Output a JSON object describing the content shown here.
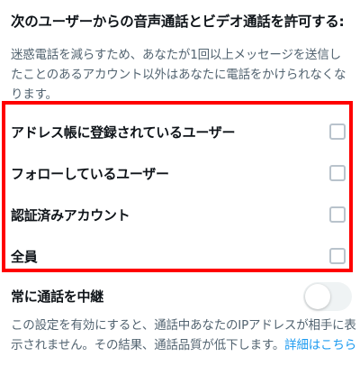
{
  "heading": "次のユーザーからの音声通話とビデオ通話を許可する:",
  "description": "迷惑電話を減らすため、あなたが1回以上メッセージを送信したことのあるアカウント以外はあなたに電話をかけられなくなります。",
  "options": [
    {
      "label": "アドレス帳に登録されているユーザー",
      "checked": false
    },
    {
      "label": "フォローしているユーザー",
      "checked": false
    },
    {
      "label": "認証済みアカウント",
      "checked": false
    },
    {
      "label": "全員",
      "checked": false
    }
  ],
  "relay": {
    "label": "常に通話を中継",
    "enabled": false,
    "description": "この設定を有効にすると、通話中あなたのIPアドレスが相手に表示されません。その結果、通話品質が低下します。",
    "link_text": "詳細はこちら"
  },
  "colors": {
    "highlight": "#ff0000",
    "link": "#1d9bf0",
    "secondary_text": "#536471"
  }
}
